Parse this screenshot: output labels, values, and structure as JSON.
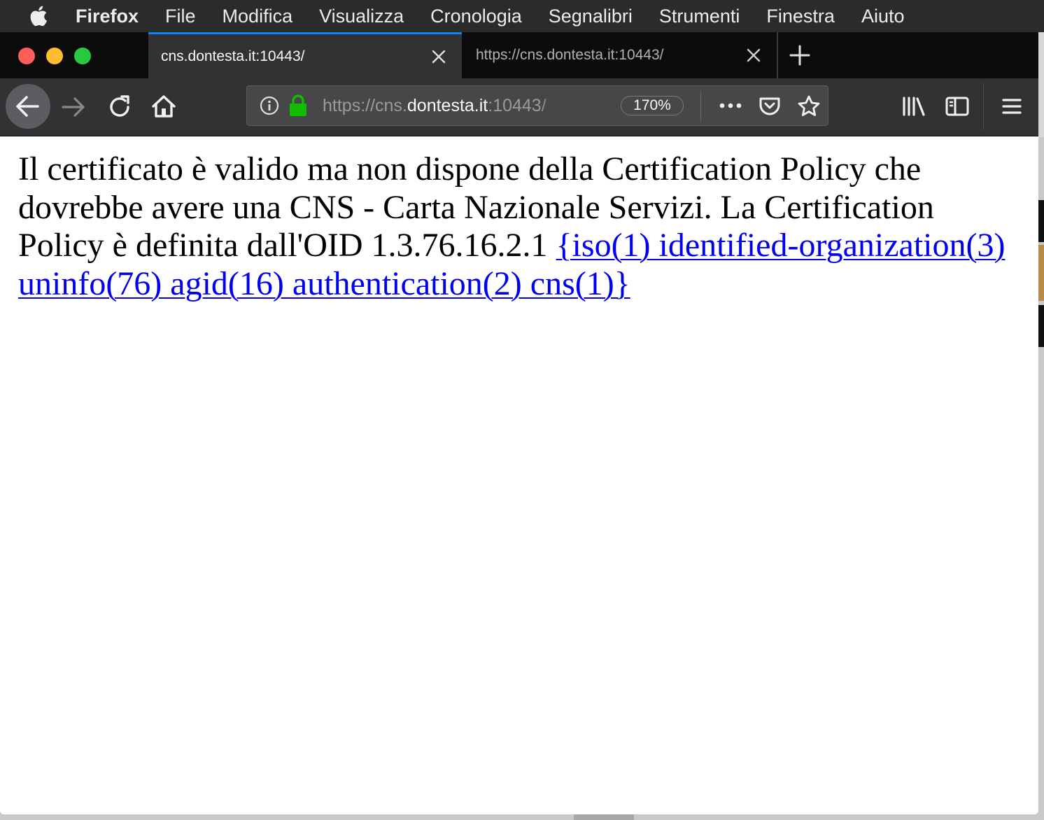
{
  "menubar": {
    "app_name": "Firefox",
    "items": [
      "File",
      "Modifica",
      "Visualizza",
      "Cronologia",
      "Segnalibri",
      "Strumenti",
      "Finestra",
      "Aiuto"
    ]
  },
  "tabs": [
    {
      "title": "cns.dontesta.it:10443/",
      "active": true
    },
    {
      "title": "https://cns.dontesta.it:10443/",
      "active": false
    }
  ],
  "urlbar": {
    "scheme": "https://cns.",
    "host": "dontesta.it",
    "rest": ":10443/",
    "zoom": "170%"
  },
  "page": {
    "message": "Il certificato è valido ma non dispone della Certification Policy che dovrebbe avere una CNS - Carta Nazionale Servizi. La Certification Policy è definita dall'OID 1.3.76.16.2.1",
    "oid_link": "{iso(1) identified-organization(3) uninfo(76) agid(16) authentication(2) cns(1)}"
  },
  "colors": {
    "accent": "#0a84ff",
    "lock": "#12bc00",
    "link": "#0000ee"
  },
  "icons": [
    "apple-icon",
    "close-icon",
    "plus-icon",
    "back-arrow-icon",
    "forward-arrow-icon",
    "reload-icon",
    "home-icon",
    "info-icon",
    "lock-icon",
    "ellipsis-icon",
    "pocket-icon",
    "star-icon",
    "library-icon",
    "sidebar-icon",
    "hamburger-menu-icon"
  ]
}
